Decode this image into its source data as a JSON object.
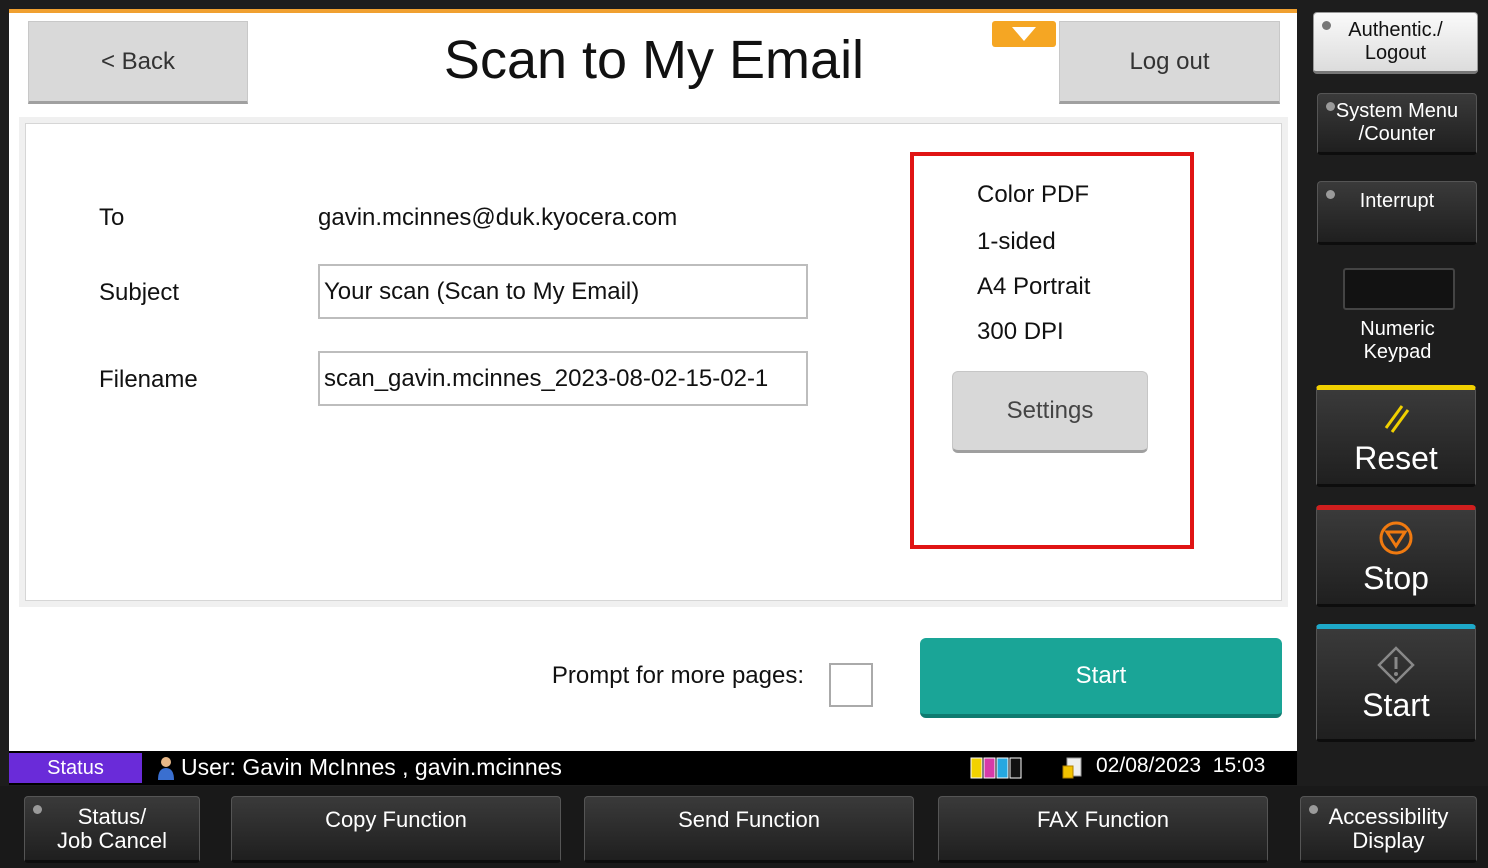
{
  "header": {
    "back_label": "< Back",
    "title": "Scan to My Email",
    "logout_label": "Log out"
  },
  "form": {
    "to_label": "To",
    "to_value": "gavin.mcinnes@duk.kyocera.com",
    "subject_label": "Subject",
    "subject_value": "Your scan (Scan to My Email)",
    "filename_label": "Filename",
    "filename_value": "scan_gavin.mcinnes_2023-08-02-15-02-1"
  },
  "settings": {
    "color": "Color PDF",
    "sides": "1-sided",
    "paper": "A4 Portrait",
    "resolution": "300 DPI",
    "button_label": "Settings"
  },
  "actions": {
    "prompt_label": "Prompt for more pages:",
    "prompt_checked": false,
    "start_label": "Start"
  },
  "statusbar": {
    "status_label": "Status",
    "user_text": "User: Gavin McInnes , gavin.mcinnes",
    "date": "02/08/2023",
    "time": "15:03"
  },
  "panel": {
    "auth_line1": "Authentic./",
    "auth_line2": "Logout",
    "sysmenu_line1": "System Menu",
    "sysmenu_line2": "/Counter",
    "interrupt": "Interrupt",
    "keypad_line1": "Numeric",
    "keypad_line2": "Keypad",
    "reset": "Reset",
    "stop": "Stop",
    "start": "Start"
  },
  "bottom": {
    "status_line1": "Status/",
    "status_line2": "Job Cancel",
    "copy": "Copy Function",
    "send": "Send Function",
    "fax": "FAX Function",
    "access_line1": "Accessibility",
    "access_line2": "Display"
  },
  "colors": {
    "accent_orange": "#f5a623",
    "start_teal": "#1aa597",
    "status_purple": "#6a2bd9",
    "highlight_red": "#e01414",
    "reset_yellow": "#f0d000",
    "stop_red": "#d01e1e",
    "start_blue": "#1ea9c9"
  }
}
